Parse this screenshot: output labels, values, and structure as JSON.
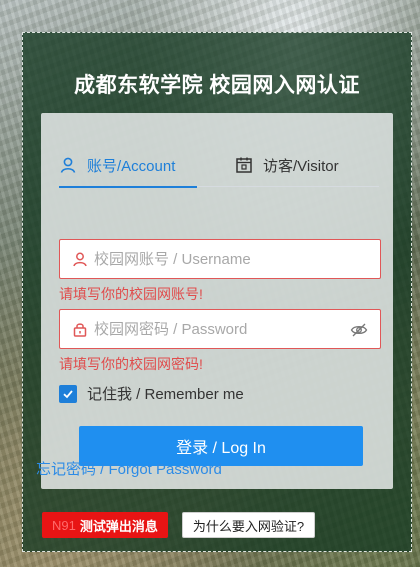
{
  "title": "成都东软学院 校园网入网认证",
  "tabs": [
    {
      "label": "账号/Account",
      "icon": "user-icon",
      "active": true
    },
    {
      "label": "访客/Visitor",
      "icon": "calendar-icon",
      "active": false
    }
  ],
  "username": {
    "placeholder": "校园网账号 / Username",
    "value": "",
    "error": "请填写你的校园网账号!",
    "icon": "user-icon"
  },
  "password": {
    "placeholder": "校园网密码 / Password",
    "value": "",
    "error": "请填写你的校园网密码!",
    "icon": "lock-icon",
    "toggle_icon": "eye-off-icon"
  },
  "remember": {
    "label": "记住我 / Remember me",
    "checked": true
  },
  "login_button": {
    "label": "登录 / Log In"
  },
  "forgot_link": {
    "label": "忘记密码 / Forgot Password"
  },
  "bottom": {
    "test_button": {
      "number": "N91",
      "label": "测试弹出消息"
    },
    "why_button": {
      "label": "为什么要入网验证?"
    }
  },
  "colors": {
    "accent": "#1e7fd9",
    "error": "#e04c4c",
    "panel": "#163a22",
    "test_button": "#e81414"
  }
}
